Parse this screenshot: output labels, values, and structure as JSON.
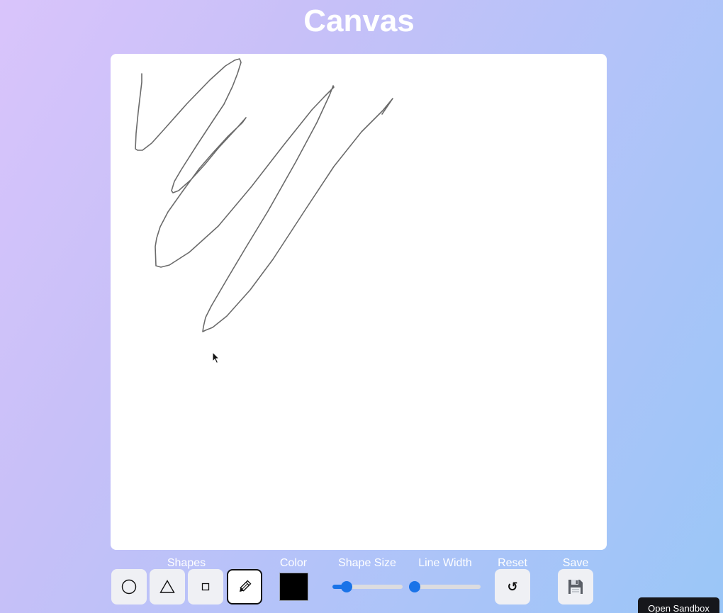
{
  "app": {
    "title": "Canvas"
  },
  "toolbar": {
    "shapes_label": "Shapes",
    "color_label": "Color",
    "shape_size_label": "Shape Size",
    "line_width_label": "Line Width",
    "reset_label": "Reset",
    "save_label": "Save",
    "shapes": [
      {
        "name": "circle",
        "icon": "circle-icon",
        "active": false
      },
      {
        "name": "triangle",
        "icon": "triangle-icon",
        "active": false
      },
      {
        "name": "square",
        "icon": "square-icon",
        "active": false
      },
      {
        "name": "pencil",
        "icon": "pencil-icon",
        "active": true
      }
    ],
    "color_value": "#000000",
    "shape_size_value": 0.2,
    "line_width_value": 0.06,
    "reset_icon": "↺",
    "save_icon": "floppy-disk-icon"
  },
  "canvas": {
    "background": "#ffffff",
    "stroke_color": "#6b6b6b"
  },
  "sandbox_button": {
    "label": "Open Sandbox"
  },
  "colors": {
    "accent": "#1a73e8",
    "title_text": "#ffffff"
  }
}
